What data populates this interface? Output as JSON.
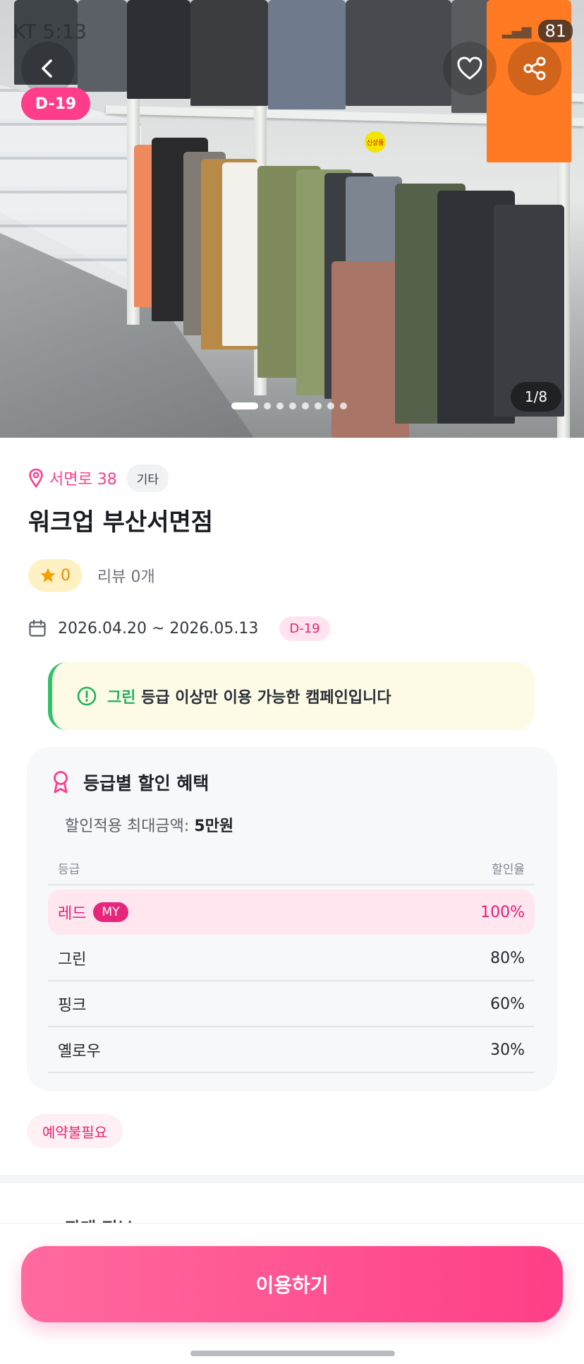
{
  "status_bar": {
    "carrier_time": "KT 5:13",
    "battery": "81"
  },
  "hero": {
    "dday": "D-19",
    "counter": "1/8",
    "slide_count": 8,
    "active_slide": 1,
    "price_tag_text": "신상품"
  },
  "store": {
    "location": "서면로 38",
    "category": "기타",
    "name": "워크업 부산서면점",
    "rating": "0",
    "reviews": "리뷰 0개",
    "period": "2026.04.20 ~ 2026.05.13",
    "dday": "D-19"
  },
  "notice": {
    "highlight": "그린",
    "text": "등급 이상만 이용 가능한 캠페인입니다"
  },
  "benefit": {
    "title": "등급별 할인 혜택",
    "max_label": "할인적용 최대금액: ",
    "max_value": "5만원",
    "col_grade": "등급",
    "col_rate": "할인율",
    "my_badge": "MY",
    "tiers": [
      {
        "name": "레드",
        "rate": "100%"
      },
      {
        "name": "그린",
        "rate": "80%"
      },
      {
        "name": "핑크",
        "rate": "60%"
      },
      {
        "name": "옐로우",
        "rate": "30%"
      }
    ]
  },
  "reservation_chip": "예약불필요",
  "next_section_title": "판매 정보",
  "cta_label": "이용하기",
  "colors": {
    "accent": "#ff3d8b",
    "green": "#1db35c",
    "star": "#f5a000"
  }
}
